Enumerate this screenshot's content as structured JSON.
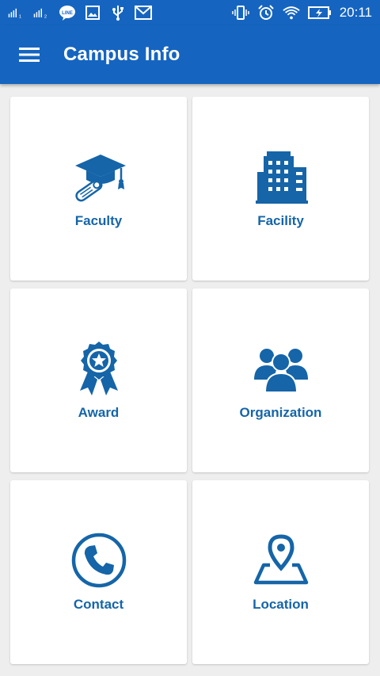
{
  "status_bar": {
    "time": "20:11",
    "left_icons": [
      "signal-sim1-icon",
      "signal-sim2-icon",
      "line-app-icon",
      "image-icon",
      "usb-icon",
      "gmail-icon"
    ],
    "right_icons": [
      "vibrate-icon",
      "alarm-icon",
      "wifi-icon",
      "battery-charging-icon"
    ]
  },
  "app_bar": {
    "title": "Campus Info",
    "menu_icon": "hamburger-menu-icon",
    "color": "#1565c0"
  },
  "accent_color": "#1565a8",
  "tiles": [
    {
      "label": "Faculty",
      "icon": "graduation-cap-icon"
    },
    {
      "label": "Facility",
      "icon": "building-icon"
    },
    {
      "label": "Award",
      "icon": "award-ribbon-icon"
    },
    {
      "label": "Organization",
      "icon": "people-group-icon"
    },
    {
      "label": "Contact",
      "icon": "phone-icon"
    },
    {
      "label": "Location",
      "icon": "map-pin-icon"
    }
  ]
}
